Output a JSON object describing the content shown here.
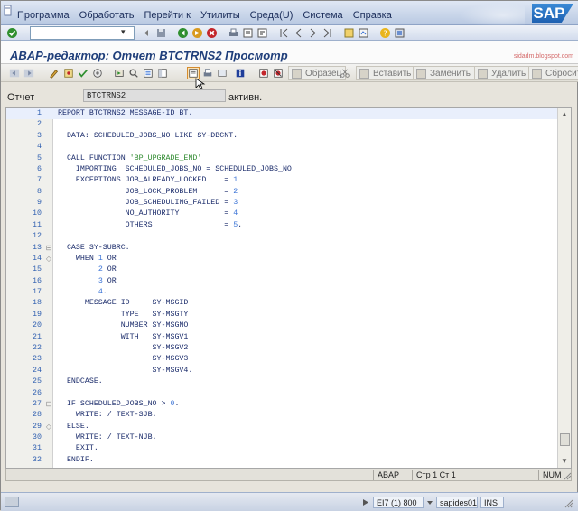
{
  "menu": [
    "Программа",
    "Обработать",
    "Перейти к",
    "Утилиты",
    "Среда(U)",
    "Система",
    "Справка"
  ],
  "brand": {
    "logo_text": "SAP",
    "watermark": "sidadm.blogspot.com"
  },
  "window_title": "ABAP-редактор: Отчет BTCTRNS2 Просмотр",
  "toolbar_text_buttons": {
    "pattern": "Образец",
    "insert": "Вставить",
    "replace": "Заменить",
    "delete": "Удалить",
    "reset": "Сбросит"
  },
  "header": {
    "label": "Отчет",
    "value": "BTCTRNS2",
    "status": "активн."
  },
  "code": [
    {
      "n": "1",
      "fold": "",
      "text": "REPORT BTCTRNS2 MESSAGE-ID BT.",
      "hl": true
    },
    {
      "n": "2",
      "fold": "",
      "text": ""
    },
    {
      "n": "3",
      "fold": "",
      "text": "  DATA: SCHEDULED_JOBS_NO LIKE SY-DBCNT."
    },
    {
      "n": "4",
      "fold": "",
      "text": ""
    },
    {
      "n": "5",
      "fold": "",
      "text": "  CALL FUNCTION 'BP_UPGRADE_END'"
    },
    {
      "n": "6",
      "fold": "",
      "text": "    IMPORTING  SCHEDULED_JOBS_NO = SCHEDULED_JOBS_NO"
    },
    {
      "n": "7",
      "fold": "",
      "text": "    EXCEPTIONS JOB_ALREADY_LOCKED    = 1"
    },
    {
      "n": "8",
      "fold": "",
      "text": "               JOB_LOCK_PROBLEM      = 2"
    },
    {
      "n": "9",
      "fold": "",
      "text": "               JOB_SCHEDULING_FAILED = 3"
    },
    {
      "n": "10",
      "fold": "",
      "text": "               NO_AUTHORITY          = 4"
    },
    {
      "n": "11",
      "fold": "",
      "text": "               OTHERS                = 5."
    },
    {
      "n": "12",
      "fold": "",
      "text": ""
    },
    {
      "n": "13",
      "fold": "⊟",
      "text": "  CASE SY-SUBRC."
    },
    {
      "n": "14",
      "fold": "◇",
      "text": "    WHEN 1 OR"
    },
    {
      "n": "15",
      "fold": "",
      "text": "         2 OR"
    },
    {
      "n": "16",
      "fold": "",
      "text": "         3 OR"
    },
    {
      "n": "17",
      "fold": "",
      "text": "         4."
    },
    {
      "n": "18",
      "fold": "",
      "text": "      MESSAGE ID     SY-MSGID"
    },
    {
      "n": "19",
      "fold": "",
      "text": "              TYPE   SY-MSGTY"
    },
    {
      "n": "20",
      "fold": "",
      "text": "              NUMBER SY-MSGNO"
    },
    {
      "n": "21",
      "fold": "",
      "text": "              WITH   SY-MSGV1"
    },
    {
      "n": "22",
      "fold": "",
      "text": "                     SY-MSGV2"
    },
    {
      "n": "23",
      "fold": "",
      "text": "                     SY-MSGV3"
    },
    {
      "n": "24",
      "fold": "",
      "text": "                     SY-MSGV4."
    },
    {
      "n": "25",
      "fold": "",
      "text": "  ENDCASE."
    },
    {
      "n": "26",
      "fold": "",
      "text": ""
    },
    {
      "n": "27",
      "fold": "⊟",
      "text": "  IF SCHEDULED_JOBS_NO > 0."
    },
    {
      "n": "28",
      "fold": "",
      "text": "    WRITE: / TEXT-SJB."
    },
    {
      "n": "29",
      "fold": "◇",
      "text": "  ELSE."
    },
    {
      "n": "30",
      "fold": "",
      "text": "    WRITE: / TEXT-NJB."
    },
    {
      "n": "31",
      "fold": "",
      "text": "    EXIT."
    },
    {
      "n": "32",
      "fold": "",
      "text": "  ENDIF."
    }
  ],
  "editor_status": {
    "lang": "ABAP",
    "position": "Стр   1 Ст   1",
    "num": "NUM"
  },
  "statusbar": {
    "system": "EI7 (1) 800",
    "server": "sapides01",
    "mode": "INS"
  },
  "colors": {
    "keyword": "#1f2f7b",
    "string": "#2f8a2f",
    "number": "#3a73d6",
    "title": "#1f3e7a"
  }
}
